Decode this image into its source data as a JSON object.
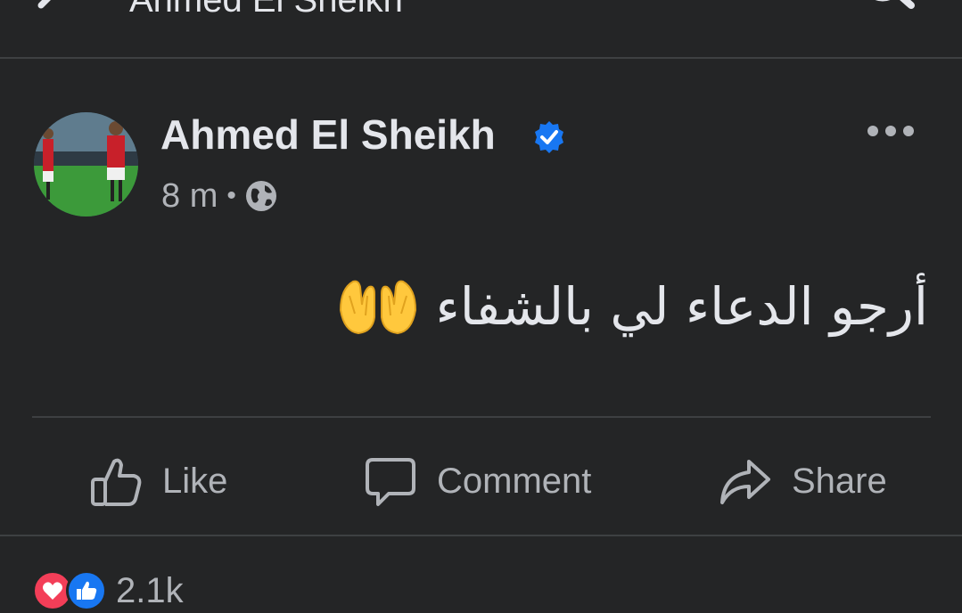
{
  "topbar": {
    "title": "Ahmed El Sheikh",
    "back_icon": "arrow-left-icon",
    "search_icon": "search-icon"
  },
  "post": {
    "author": "Ahmed El Sheikh",
    "verified_icon": "verified-badge-icon",
    "time": "8 m",
    "separator": "•",
    "privacy_icon": "globe-icon",
    "more_icon": "more-options-icon",
    "text": "أرجو الدعاء لي بالشفاء",
    "emoji_icon": "folded-hands-emoji-icon"
  },
  "actions": {
    "like_label": "Like",
    "comment_label": "Comment",
    "share_label": "Share"
  },
  "reactions": {
    "icons": [
      "love-icon",
      "like-icon"
    ],
    "count": "2.1k"
  },
  "colors": {
    "background": "#242526",
    "text_primary": "#e4e6eb",
    "text_secondary": "#b0b3b8",
    "verified_blue": "#1877f2",
    "love_red": "#f33e58"
  }
}
